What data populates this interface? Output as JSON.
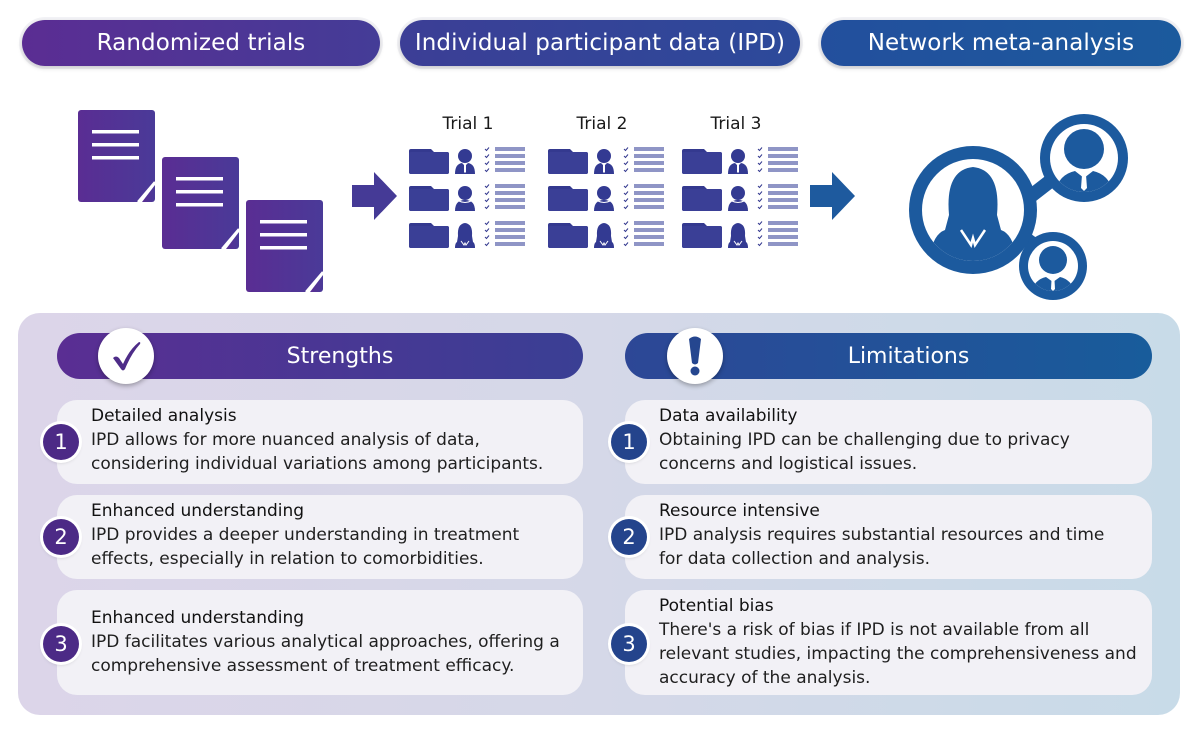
{
  "header": {
    "steps": [
      {
        "label": "Randomized trials"
      },
      {
        "label": "Individual participant data (IPD)"
      },
      {
        "label": "Network meta-analysis"
      }
    ]
  },
  "ipd": {
    "trials": [
      {
        "label": "Trial 1"
      },
      {
        "label": "Trial 2"
      },
      {
        "label": "Trial 3"
      }
    ],
    "rows_per_trial": 3,
    "icons": [
      "folder-icon",
      "participant-icon",
      "checklist-icon"
    ]
  },
  "colors": {
    "purple": "#5b2d93",
    "indigo": "#3c3e96",
    "blue": "#1b5a9d",
    "card_bg": "#f2f1f6"
  },
  "strengths": {
    "title": "Strengths",
    "icon": "check-icon",
    "items": [
      {
        "num": "1",
        "title": "Detailed analysis",
        "lines": [
          "IPD allows for more nuanced analysis of data,",
          "considering individual variations among participants."
        ]
      },
      {
        "num": "2",
        "title": "Enhanced understanding",
        "lines": [
          "IPD provides a deeper understanding in treatment",
          "effects, especially in relation to comorbidities."
        ]
      },
      {
        "num": "3",
        "title": "Enhanced understanding",
        "lines": [
          "IPD facilitates various analytical approaches, offering a",
          "comprehensive assessment of treatment efficacy."
        ]
      }
    ]
  },
  "limitations": {
    "title": "Limitations",
    "icon": "exclamation-icon",
    "items": [
      {
        "num": "1",
        "title": "Data availability",
        "lines": [
          "Obtaining IPD can be challenging due to privacy",
          "concerns and logistical issues."
        ]
      },
      {
        "num": "2",
        "title": "Resource intensive",
        "lines": [
          "IPD analysis requires substantial resources and time",
          "for data collection and analysis."
        ]
      },
      {
        "num": "3",
        "title": "Potential bias",
        "lines": [
          "There's a risk of bias if IPD is not available from all",
          "relevant studies, impacting the comprehensiveness and",
          "accuracy of the analysis."
        ]
      }
    ]
  }
}
